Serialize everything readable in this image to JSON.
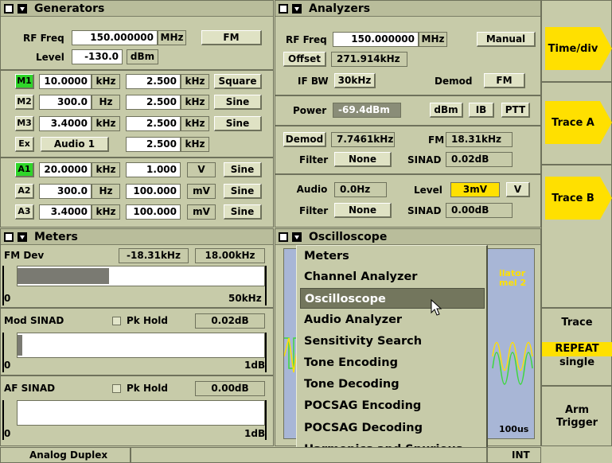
{
  "generators": {
    "title": "Generators",
    "rf_freq_label": "RF Freq",
    "rf_freq_value": "150.000000",
    "rf_freq_unit": "MHz",
    "mod_type": "FM",
    "level_label": "Level",
    "level_value": "-130.0",
    "level_unit": "dBm",
    "mod_rows": [
      {
        "id": "M1",
        "freq": "10.0000",
        "freq_unit": "kHz",
        "dev": "2.500",
        "dev_unit": "kHz",
        "wave": "Square",
        "active": true
      },
      {
        "id": "M2",
        "freq": "300.0",
        "freq_unit": "Hz",
        "dev": "2.500",
        "dev_unit": "kHz",
        "wave": "Sine",
        "active": false
      },
      {
        "id": "M3",
        "freq": "3.4000",
        "freq_unit": "kHz",
        "dev": "2.500",
        "dev_unit": "kHz",
        "wave": "Sine",
        "active": false
      },
      {
        "id": "Ex",
        "freq": "Audio 1",
        "freq_unit": "",
        "dev": "2.500",
        "dev_unit": "kHz",
        "wave": "",
        "active": false
      }
    ],
    "audio_rows": [
      {
        "id": "A1",
        "freq": "20.0000",
        "freq_unit": "kHz",
        "level": "1.000",
        "level_unit": "V",
        "wave": "Sine",
        "active": true
      },
      {
        "id": "A2",
        "freq": "300.0",
        "freq_unit": "Hz",
        "level": "100.000",
        "level_unit": "mV",
        "wave": "Sine",
        "active": false
      },
      {
        "id": "A3",
        "freq": "3.4000",
        "freq_unit": "kHz",
        "level": "100.000",
        "level_unit": "mV",
        "wave": "Sine",
        "active": false
      }
    ]
  },
  "analyzers": {
    "title": "Analyzers",
    "rf_freq_label": "RF Freq",
    "rf_freq_value": "150.000000",
    "rf_freq_unit": "MHz",
    "tune_mode": "Manual",
    "offset_label": "Offset",
    "offset_value": "271.914kHz",
    "ifbw_label": "IF BW",
    "ifbw_value": "30kHz",
    "demod_label": "Demod",
    "demod_value": "FM",
    "power_label": "Power",
    "power_value": "-69.4dBm",
    "power_unit": "dBm",
    "ib_label": "IB",
    "ptt_label": "PTT",
    "demod_btn": "Demod",
    "demod_reading": "7.7461kHz",
    "fm_label": "FM",
    "fm_reading": "18.31kHz",
    "filter_label": "Filter",
    "filter_value": "None",
    "sinad_label": "SINAD",
    "sinad_value": "0.02dB",
    "audio_btn": "Audio",
    "audio_value": "0.0Hz",
    "level_label": "Level",
    "level_value": "3mV",
    "level_unit": "V",
    "filter2_label": "Filter",
    "filter2_value": "None",
    "sinad2_label": "SINAD",
    "sinad2_value": "0.00dB"
  },
  "meters": {
    "title": "Meters",
    "fm_dev_label": "FM Dev",
    "fm_dev_value1": "-18.31kHz",
    "fm_dev_value2": "18.00kHz",
    "fm_bar_min": "0",
    "fm_bar_max": "50kHz",
    "fm_bar_fraction": 0.37,
    "mod_sinad_label": "Mod SINAD",
    "pk_hold_label": "Pk Hold",
    "mod_sinad_value": "0.02dB",
    "mod_bar_min": "0",
    "mod_bar_max": "1dB",
    "mod_bar_fraction": 0.02,
    "af_sinad_label": "AF SINAD",
    "af_pk_hold_label": "Pk Hold",
    "af_sinad_value": "0.00dB",
    "af_bar_min": "0",
    "af_bar_max": "1dB",
    "af_bar_fraction": 0.0
  },
  "oscilloscope": {
    "title": "Oscilloscope",
    "trace_label_1": "ilator",
    "trace_label_2": "mel 2",
    "timebase": "100us"
  },
  "dropdown": {
    "items": [
      "Meters",
      "Channel Analyzer",
      "Oscilloscope",
      "Audio Analyzer",
      "Sensitivity Search",
      "Tone Encoding",
      "Tone Decoding",
      "POCSAG Encoding",
      "POCSAG Decoding",
      "Harmonics and Spurious"
    ],
    "selected": "Oscilloscope"
  },
  "softkeys": {
    "time_div": "Time/div",
    "trace_a": "Trace A",
    "trace_b": "Trace B",
    "trace": "Trace",
    "repeat": "REPEAT",
    "single": "single",
    "arm": "Arm",
    "trigger": "Trigger"
  },
  "status": {
    "mode": "Analog Duplex",
    "ref": "INT"
  },
  "colors": {
    "active_green": "#2fd629",
    "softkey_yellow": "#ffe000",
    "trace_green": "#3cd83c",
    "trace_yellow": "#ffe000",
    "scope_bg": "#a8b6d6"
  }
}
